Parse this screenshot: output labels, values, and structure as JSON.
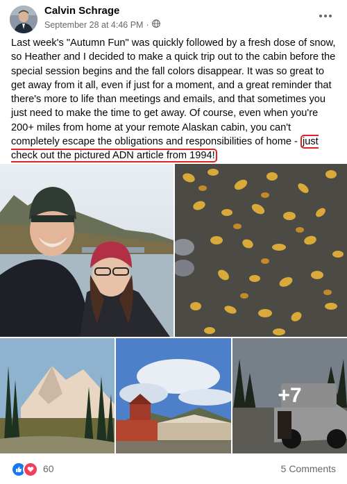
{
  "post": {
    "author": "Calvin Schrage",
    "date": "September 28 at 4:46 PM",
    "separator": "·",
    "audience_icon": "globe-icon",
    "more_icon": "more-options-icon",
    "text_before": "Last week's \"Autumn Fun\" was quickly followed by a fresh dose of snow, so Heather and I decided to make a quick trip out to the cabin before the special session begins and the fall colors disappear. It was so great to get away from it all, even if just for a moment, and a great reminder that there's more to life than meetings and emails, and that sometimes you just need to make the time to get away. Of course, even when you're 200+ miles from home at your remote Alaskan cabin, you can't completely escape the obligations and responsibilities of home - ",
    "text_highlight": "just check out the pictured ADN article from 1994!",
    "highlight_color": "#dd2222"
  },
  "photos": {
    "more_count": "+7"
  },
  "footer": {
    "reaction_icons": [
      "like-icon",
      "love-icon"
    ],
    "like_color": "#1877f2",
    "love_color": "#f33e58",
    "reaction_count": "60",
    "comments_label": "5 Comments"
  }
}
